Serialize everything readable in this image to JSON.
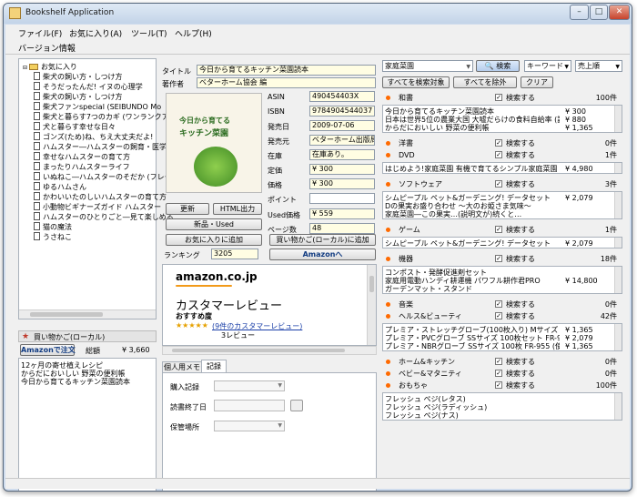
{
  "window": {
    "title": "Bookshelf Application",
    "min": "–",
    "max": "□",
    "close": "✕"
  },
  "menu": {
    "items": [
      "ファイル(F)",
      "お気に入り(A)",
      "ツール(T)",
      "ヘルプ(H)"
    ],
    "version": "バージョン情報"
  },
  "tree": {
    "root": "お気に入り",
    "items": [
      "柴犬の飼い方・しつけ方",
      "そうだったんだ! イヌの心理学",
      "柴犬の飼い方・しつけ方",
      "柴犬ファンspecial (SEIBUNDO Mo",
      "柴犬と暮らす7つのカギ (ワンランクア",
      "犬と暮らす幸せな日々",
      "ゴンズ(ため)ね、ちえ大丈夫だよ!",
      "ハムスター―ハムスターの飼育・医学",
      "幸せなハムスターの育て方",
      "まったりハムスターライフ",
      "いぬねこ―ハムスターのそだか (フレー",
      "ゆるハムさん",
      "かわいいたのしいハムスターの育て方",
      "小動物ビギナーズガイド ハムスター",
      "ハムスターのひとりごと―見て楽しめる",
      "猫の魔法",
      "うさねこ"
    ]
  },
  "cart": {
    "title": "買い物かご(ローカル)",
    "order_btn": "Amazonで注文",
    "total_label": "総額",
    "total": "¥ 3,660",
    "items": [
      "12ヶ月の寄せ植えレシピ",
      "からだにおいしい 野菜の便利帳",
      "今日から育てるキッチン菜園読本"
    ]
  },
  "detail": {
    "title_label": "タイトル",
    "title": "今日から育てるキッチン菜園読本",
    "author_label": "著作者",
    "author": "ベターホーム協会 編",
    "cover_lines": [
      "今日から育てる",
      "キッチン菜園"
    ],
    "asin_label": "ASIN",
    "asin": "490454403X",
    "isbn_label": "ISBN",
    "isbn": "9784904544037",
    "date_label": "発売日",
    "date": "2009-07-06",
    "pub_label": "発売元",
    "pub": "ベターホーム出版局",
    "stock_label": "在庫",
    "stock": "在庫あり。",
    "list_label": "定価",
    "list_price": "¥ 300",
    "price_label": "価格",
    "price": "¥ 300",
    "point_label": "ポイント",
    "point": "",
    "used_label": "Used価格",
    "used": "¥ 559",
    "pages_label": "ページ数",
    "pages": "48",
    "rank_label": "ランキング",
    "rank": "3205",
    "btn_update": "更新",
    "btn_html": "HTML出力",
    "btn_new_used": "新品・Used",
    "btn_fav": "お気に入りに追加",
    "btn_cart": "買い物かご(ローカル)に追加",
    "btn_amazon": "Amazonへ"
  },
  "review": {
    "logo": "amazon.co.jp",
    "heading": "カスタマーレビュー",
    "sub": "おすすめ度",
    "stars": "★★★★★",
    "count": "(9件のカスタマーレビュー)",
    "more": "3レビュー"
  },
  "memo": {
    "tabs": [
      "個人用メモ",
      "記録"
    ],
    "f1": "購入記録",
    "f2": "読書終了日",
    "f3": "保管場所"
  },
  "search": {
    "query": "家庭菜園",
    "btn": "検索",
    "mode": "キーワード",
    "sort": "売上順",
    "all_target": "すべてを検索対象",
    "all_exclude": "すべてを除外",
    "clear": "クリア"
  },
  "categories": [
    {
      "name": "和書",
      "check": "検索する",
      "count": "100件",
      "items": [
        [
          "今日から育てるキッチン菜園読本",
          "¥ 300"
        ],
        [
          "日本は世界5位の農業大国 大嘘だらけの食料自給率 (講…",
          "¥ 880"
        ],
        [
          "からだにおいしい 野菜の便利帳",
          "¥ 1,365"
        ]
      ]
    },
    {
      "name": "洋書",
      "check": "検索する",
      "count": "0件",
      "items": []
    },
    {
      "name": "DVD",
      "check": "検索する",
      "count": "1件",
      "items": [
        [
          "はじめよう!家庭菜園 有機で育てるシンプル家庭菜園 [秋冬編]…",
          "¥ 4,980"
        ]
      ]
    },
    {
      "name": "ソフトウェア",
      "check": "検索する",
      "count": "3件",
      "items": [
        [
          "シムピープル ペット&ガーデニング! データセット",
          "¥ 2,079"
        ],
        [
          "Dの果実お盛り合わせ ～大のお姫さま気味～",
          ""
        ],
        [
          "家庭菜園―この果実…(説明文が)続くと…",
          ""
        ]
      ]
    },
    {
      "name": "ゲーム",
      "check": "検索する",
      "count": "1件",
      "items": [
        [
          "シムピープル ペット&ガーデニング! データセット",
          "¥ 2,079"
        ]
      ]
    },
    {
      "name": "機器",
      "check": "検索する",
      "count": "18件",
      "items": [
        [
          "コンポスト・発酵促進剤セット",
          ""
        ],
        [
          "家庭用電動ハンディ耕運機 パワフル耕作君PRO",
          "¥ 14,800"
        ],
        [
          "ガーデンマット・スタンド",
          ""
        ]
      ]
    },
    {
      "name": "音楽",
      "check": "検索する",
      "count": "0件",
      "items": []
    },
    {
      "name": "ヘルス&ビューティ",
      "check": "検索する",
      "count": "42件",
      "items": [
        [
          "プレミア・ストレッチグローブ(100枚入り) Mサイズ",
          "¥ 1,365"
        ],
        [
          "プレミア・PVCグローブ SSサイズ 100枚セット FR-950 (使…",
          "¥ 2,079"
        ],
        [
          "プレミア・NBRグローブ SSサイズ 100枚 FR-955 (使い捨て…",
          "¥ 1,365"
        ]
      ]
    },
    {
      "name": "ホーム&キッチン",
      "check": "検索する",
      "count": "0件",
      "items": []
    },
    {
      "name": "ベビー&マタニティ",
      "check": "検索する",
      "count": "0件",
      "items": []
    },
    {
      "name": "おもちゃ",
      "check": "検索する",
      "count": "100件",
      "items": [
        [
          "フレッシュ ペジ(レタス)",
          ""
        ],
        [
          "フレッシュ ペジ(ラディッシュ)",
          ""
        ],
        [
          "フレッシュ ペジ(ナス)",
          ""
        ]
      ]
    }
  ]
}
